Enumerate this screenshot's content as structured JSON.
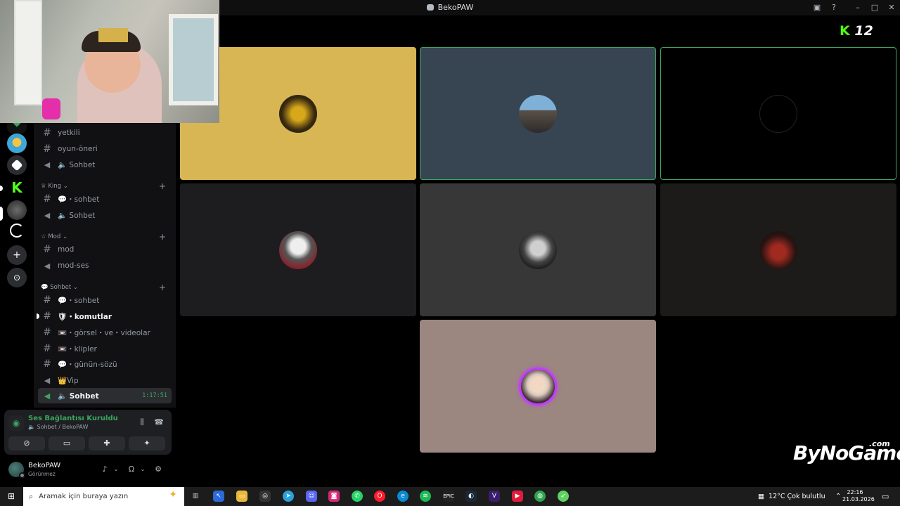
{
  "window": {
    "title": "BekoPAW"
  },
  "channels": [
    {
      "type": "text",
      "name": "yetkili"
    },
    {
      "type": "text",
      "name": "oyun-öneri"
    },
    {
      "type": "voice",
      "name": "🔈 Sohbet"
    }
  ],
  "categories": {
    "king": {
      "label": "♕ King ⌄",
      "items": [
        {
          "type": "text",
          "name": "💬・sohbet"
        },
        {
          "type": "voice",
          "name": "🔈 Sohbet"
        }
      ]
    },
    "mod": {
      "label": "☆ Mod ⌄",
      "items": [
        {
          "type": "text",
          "name": "mod"
        },
        {
          "type": "voice",
          "name": "mod-ses"
        }
      ]
    },
    "sohbet": {
      "label": "💬 Sohbet ⌄",
      "items": [
        {
          "type": "text",
          "name": "💬・sohbet"
        },
        {
          "type": "text",
          "name": "🛡・komutlar"
        },
        {
          "type": "text",
          "name": "📼・görsel・ve・videolar"
        },
        {
          "type": "text",
          "name": "📼・klipler"
        },
        {
          "type": "text",
          "name": "💬・günün-sözü"
        },
        {
          "type": "voice",
          "name": "👑Vip"
        },
        {
          "type": "voice",
          "name": "🔈 Sohbet",
          "timer": "1:17:51"
        }
      ]
    }
  },
  "voice_panel": {
    "status": "Ses Bağlantısı Kuruldu",
    "channel": "🔈 Sohbet / BekoPAW"
  },
  "user_panel": {
    "name": "BekoPAW",
    "status": "Görünmez"
  },
  "stage": {
    "kick_label": "12",
    "watermark_main": "ByNoGame",
    "watermark_sub": ".com"
  },
  "taskbar": {
    "search_placeholder": "Aramak için buraya yazın",
    "weather": "12°C  Çok bulutlu",
    "time": "22:16",
    "date": "21.03.2026"
  }
}
